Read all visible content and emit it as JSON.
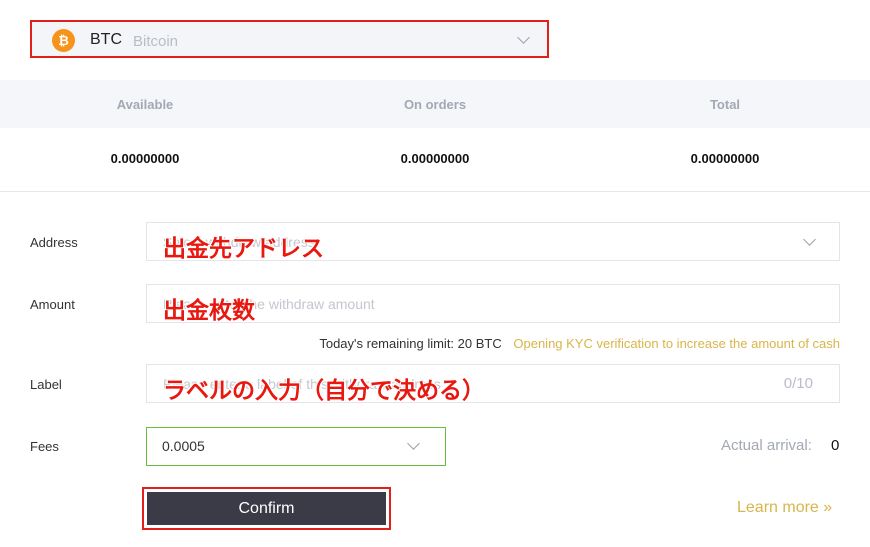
{
  "coin": {
    "symbol": "BTC",
    "name": "Bitcoin",
    "icon": "bitcoin-icon",
    "icon_glyph": "₿",
    "icon_color": "#f7931a"
  },
  "balances": {
    "headers": [
      "Available",
      "On orders",
      "Total"
    ],
    "values": [
      "0.00000000",
      "0.00000000",
      "0.00000000"
    ]
  },
  "form": {
    "address": {
      "label": "Address",
      "placeholder": "Select withdraw address",
      "annotation": "出金先アドレス"
    },
    "amount": {
      "label": "Amount",
      "placeholder": "Please enter the withdraw amount",
      "annotation": "出金枚数"
    },
    "limit": {
      "label": "Today's remaining limit:",
      "value": "20 BTC",
      "kyc_link": "Opening KYC verification to increase the amount of cash"
    },
    "label_field": {
      "label": "Label",
      "placeholder": "Please enter a label of this withdraw address",
      "counter": "0/10",
      "annotation": "ラベルの入力（自分で決める）"
    },
    "fees": {
      "label": "Fees",
      "value": "0.0005"
    },
    "arrival": {
      "label": "Actual arrival:",
      "value": "0"
    },
    "confirm_label": "Confirm",
    "learn_more": "Learn more »"
  },
  "colors": {
    "accent": "#d9b54a",
    "highlight_border": "#e0201a",
    "button_bg": "#3a3b47",
    "fees_border": "#6abf3a"
  }
}
